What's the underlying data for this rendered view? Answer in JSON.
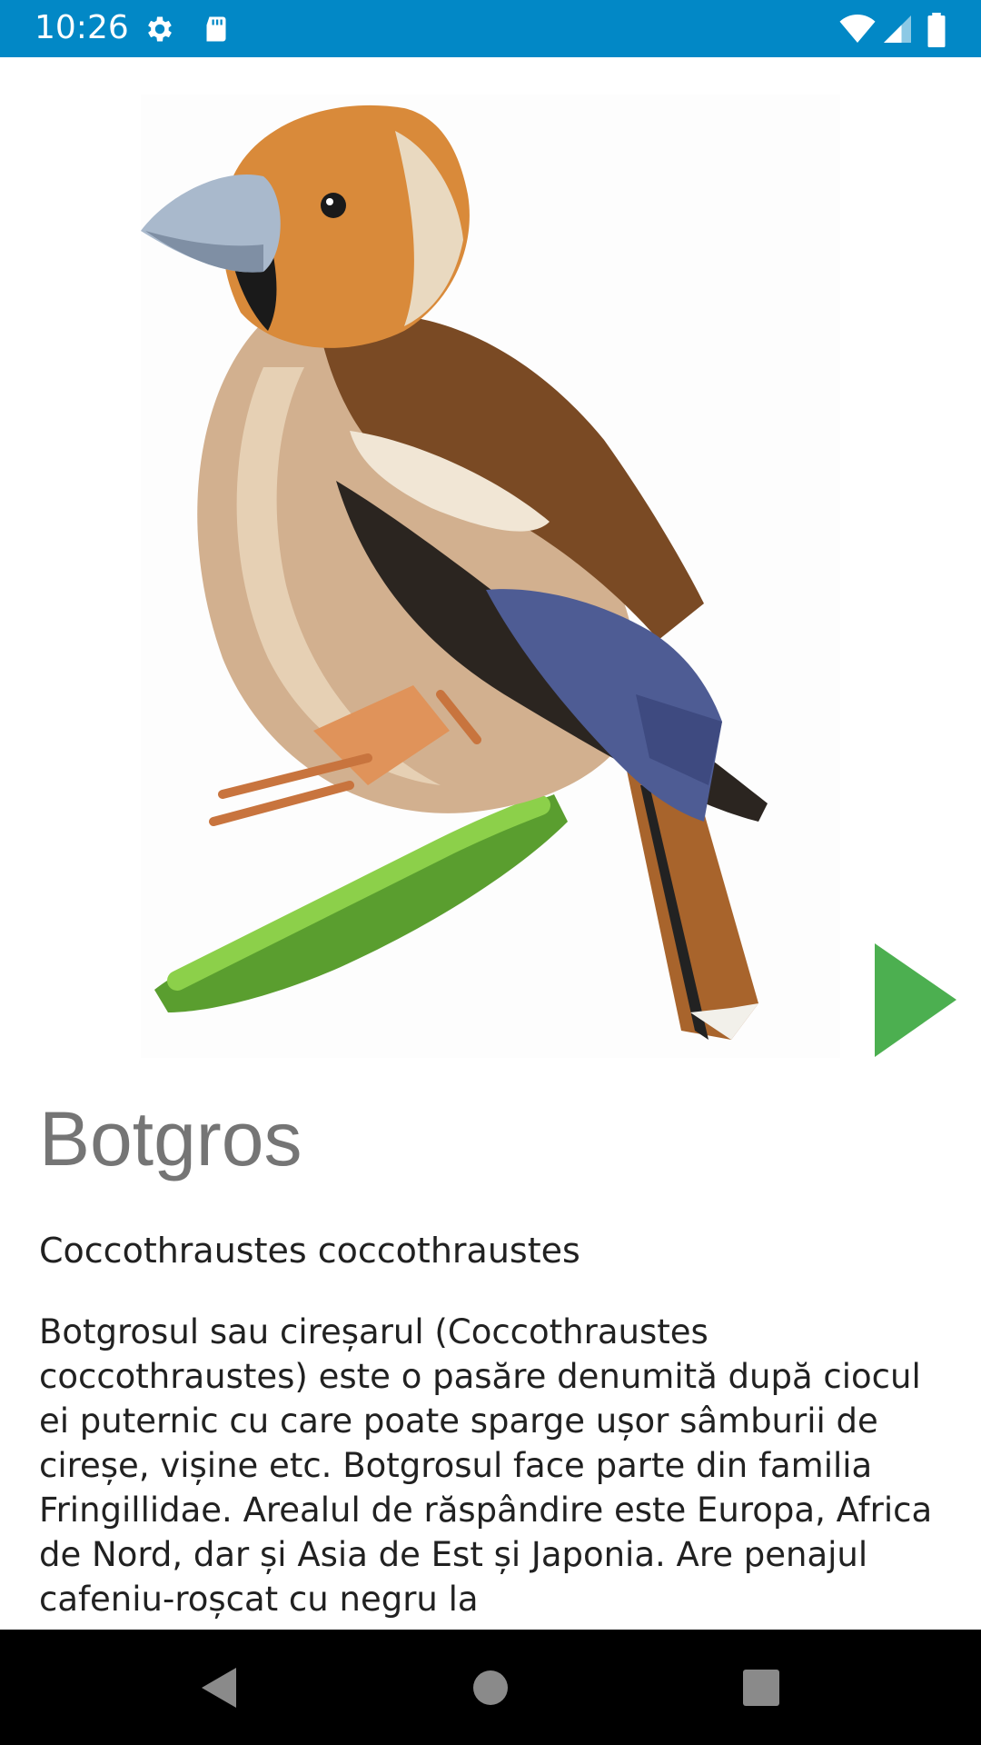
{
  "status_bar": {
    "time": "10:26",
    "icons": [
      "gear-icon",
      "sd-card-icon",
      "wifi-icon",
      "signal-icon",
      "battery-icon"
    ],
    "background_color": "#0288c6"
  },
  "bird": {
    "common_name": "Botgros",
    "scientific_name": "Coccothraustes coccothraustes",
    "description": "Botgrosul sau cireșarul (Coccothraustes coccothraustes) este o pasăre denumită după ciocul ei puternic cu care poate sparge ușor sâmburii de cireșe, vișine etc. Botgrosul face parte din familia Fringillidae. Arealul de răspândire este Europa, Africa de Nord, dar și Asia de Est și Japonia. Are penajul cafeniu-roșcat cu negru la"
  },
  "controls": {
    "play_icon": "play-icon",
    "play_color": "#4caf50"
  },
  "nav_bar": {
    "back_icon": "back-triangle-icon",
    "home_icon": "home-circle-icon",
    "recents_icon": "recents-square-icon"
  }
}
